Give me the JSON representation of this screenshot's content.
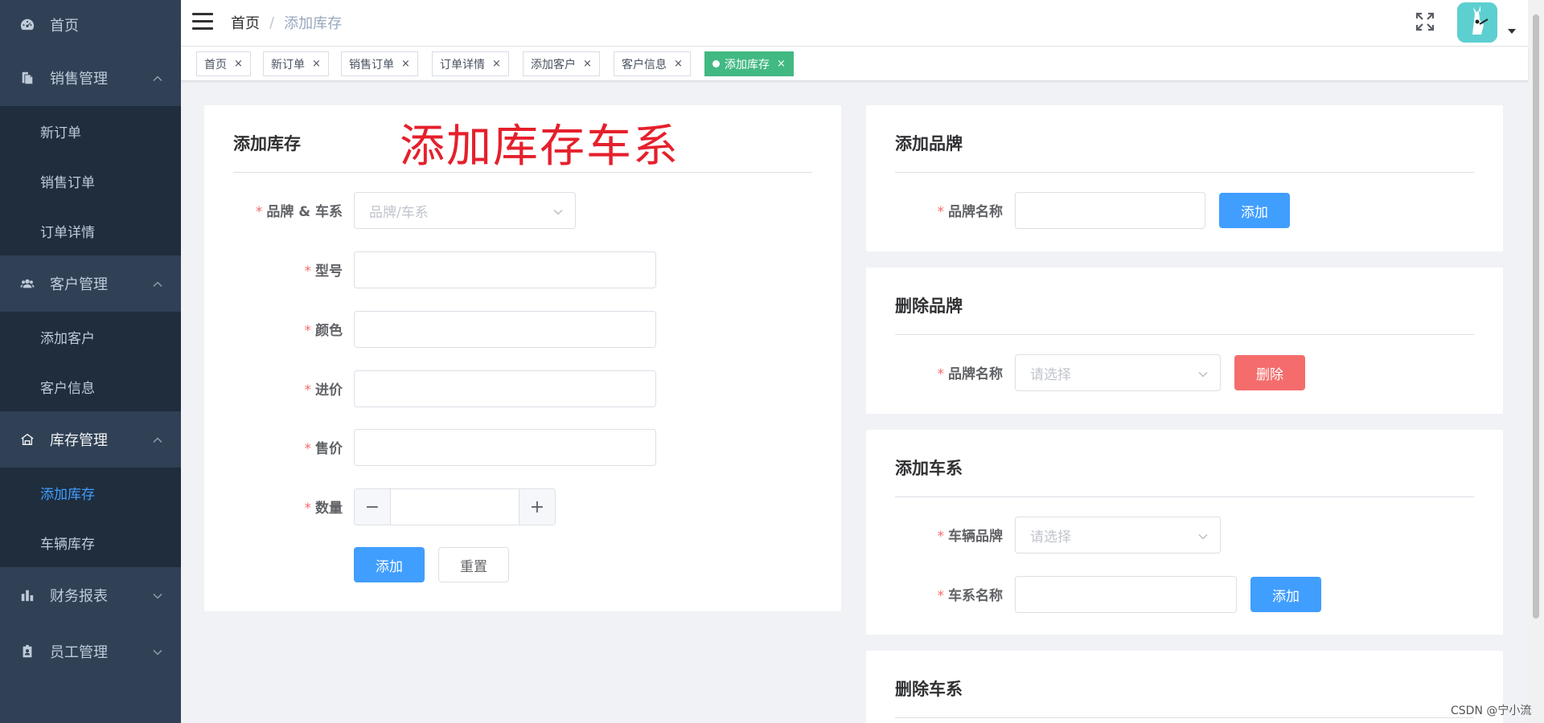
{
  "sidebar": {
    "home": {
      "label": "首页",
      "icon": "dashboard-icon"
    },
    "sales": {
      "label": "销售管理",
      "icon": "documents-icon",
      "items": [
        {
          "label": "新订单"
        },
        {
          "label": "销售订单"
        },
        {
          "label": "订单详情"
        }
      ]
    },
    "customers": {
      "label": "客户管理",
      "icon": "users-icon",
      "items": [
        {
          "label": "添加客户"
        },
        {
          "label": "客户信息"
        }
      ]
    },
    "inventory": {
      "label": "库存管理",
      "icon": "warehouse-icon",
      "items": [
        {
          "label": "添加库存",
          "active": true
        },
        {
          "label": "车辆库存"
        }
      ]
    },
    "finance": {
      "label": "财务报表",
      "icon": "bar-chart-icon"
    },
    "staff": {
      "label": "员工管理",
      "icon": "badge-icon"
    }
  },
  "navbar": {
    "breadcrumb": {
      "home": "首页",
      "separator": "/",
      "current": "添加库存"
    }
  },
  "tags": [
    {
      "label": "首页",
      "close": "×"
    },
    {
      "label": "新订单",
      "close": "×"
    },
    {
      "label": "销售订单",
      "close": "×"
    },
    {
      "label": "订单详情",
      "close": "×"
    },
    {
      "label": "添加客户",
      "close": "×"
    },
    {
      "label": "客户信息",
      "close": "×"
    },
    {
      "label": "添加库存",
      "close": "×",
      "active": true
    }
  ],
  "add_stock": {
    "title": "添加库存",
    "annotation": "添加库存车系",
    "fields": {
      "brand_series": {
        "label": "品牌 & 车系",
        "placeholder": "品牌/车系"
      },
      "model": {
        "label": "型号",
        "value": ""
      },
      "color": {
        "label": "颜色",
        "value": ""
      },
      "purchase_price": {
        "label": "进价",
        "value": ""
      },
      "sale_price": {
        "label": "售价",
        "value": ""
      },
      "quantity": {
        "label": "数量",
        "value": "",
        "minus": "−",
        "plus": "+"
      }
    },
    "required_mark": "*",
    "add_button": "添加",
    "reset_button": "重置"
  },
  "add_brand": {
    "title": "添加品牌",
    "label": "品牌名称",
    "value": "",
    "button": "添加"
  },
  "delete_brand": {
    "title": "删除品牌",
    "label": "品牌名称",
    "placeholder": "请选择",
    "button": "删除"
  },
  "add_series": {
    "title": "添加车系",
    "brand_label": "车辆品牌",
    "brand_placeholder": "请选择",
    "name_label": "车系名称",
    "name_value": "",
    "button": "添加"
  },
  "delete_series": {
    "title": "删除车系"
  },
  "watermark": "CSDN @宁小流",
  "colors": {
    "primary": "#409eff",
    "danger": "#f56c6c",
    "tag_active": "#42b983",
    "sidebar_bg": "#304156",
    "submenu_bg": "#1f2d3d",
    "annotation": "#e5202c"
  }
}
